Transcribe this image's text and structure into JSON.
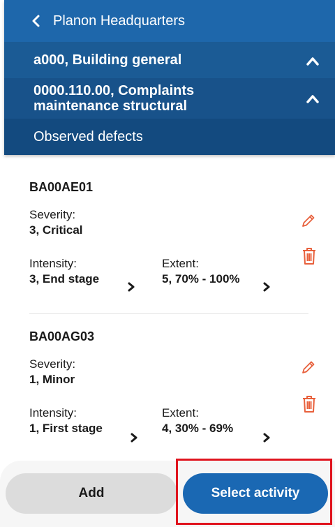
{
  "header": {
    "back_title": "Planon Headquarters",
    "level1": "a000, Building general",
    "level2": "0000.110.00, Complaints maintenance structural",
    "level3": "Observed defects"
  },
  "defects": [
    {
      "code": "BA00AE01",
      "severity_label": "Severity:",
      "severity_value": "3, Critical",
      "intensity_label": "Intensity:",
      "intensity_value": "3, End stage",
      "extent_label": "Extent:",
      "extent_value": "5, 70% - 100%"
    },
    {
      "code": "BA00AG03",
      "severity_label": "Severity:",
      "severity_value": "1, Minor",
      "intensity_label": "Intensity:",
      "intensity_value": "1, First stage",
      "extent_label": "Extent:",
      "extent_value": "4, 30% - 69%"
    }
  ],
  "footer": {
    "add_label": "Add",
    "select_label": "Select activity"
  },
  "colors": {
    "header_blue": "#1d5f9d",
    "primary_button": "#1a68b3",
    "action_icon": "#e8603c",
    "highlight": "#e0141e"
  }
}
